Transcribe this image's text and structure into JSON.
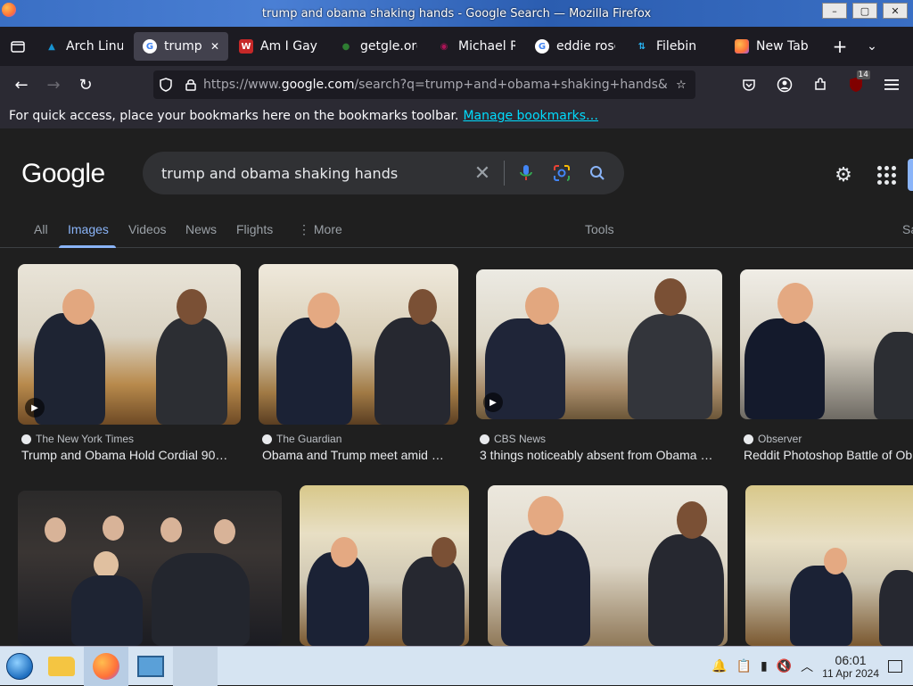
{
  "window": {
    "title": "trump and obama shaking hands - Google Search — Mozilla Firefox",
    "min": "–",
    "max": "▢",
    "close": "✕"
  },
  "tabs": [
    {
      "label": "Arch Linux",
      "icon": "arch-icon",
      "color": "#1793d1",
      "glyph": "A"
    },
    {
      "label": "trump a",
      "icon": "google-icon",
      "color": "#ffffff",
      "glyph": "G",
      "active": true
    },
    {
      "label": "Am I Gay",
      "icon": "site-icon",
      "color": "#c62828",
      "glyph": "W"
    },
    {
      "label": "getgle.org",
      "icon": "site-icon",
      "color": "#2e7d32",
      "glyph": "g"
    },
    {
      "label": "Michael R",
      "icon": "site-icon",
      "color": "#ad1457",
      "glyph": "M"
    },
    {
      "label": "eddie rose",
      "icon": "google-icon",
      "color": "#ffffff",
      "glyph": "G"
    },
    {
      "label": "Filebin",
      "icon": "filebin-icon",
      "color": "#1c1b22",
      "glyph": "⇅"
    },
    {
      "label": "New Tab",
      "icon": "firefox-icon",
      "color": "#ff7139",
      "glyph": ""
    }
  ],
  "tab_close": "✕",
  "tab_new": "+",
  "tab_list": "⌄",
  "nav": {
    "back": "←",
    "forward": "→",
    "reload": "↻",
    "url_prefix": "https://www.",
    "url_domain": "google.com",
    "url_rest": "/search?q=trump+and+obama+shaking+hands&",
    "badge": "14"
  },
  "bookmarks_toolbar": {
    "text": "For quick access, place your bookmarks here on the bookmarks toolbar.",
    "link": "Manage bookmarks…"
  },
  "google": {
    "logo": "Google",
    "query": "trump and obama shaking hands",
    "tabs": [
      "All",
      "Images",
      "Videos",
      "News",
      "Flights",
      "⋮ More"
    ],
    "tools": "Tools",
    "safesearch": "Sa"
  },
  "results_row1": [
    {
      "source": "The New York Times",
      "caption": "Trump and Obama Hold Cordial 90…",
      "video": true
    },
    {
      "source": "The Guardian",
      "caption": "Obama and Trump meet amid …",
      "video": false
    },
    {
      "source": "CBS News",
      "caption": "3 things noticeably absent from Obama …",
      "video": true
    },
    {
      "source": "Observer",
      "caption": "Reddit Photoshop Battle of Ob",
      "video": false
    }
  ],
  "play_glyph": "▶",
  "taskbar": {
    "time": "06:01",
    "date": "11 Apr 2024"
  }
}
